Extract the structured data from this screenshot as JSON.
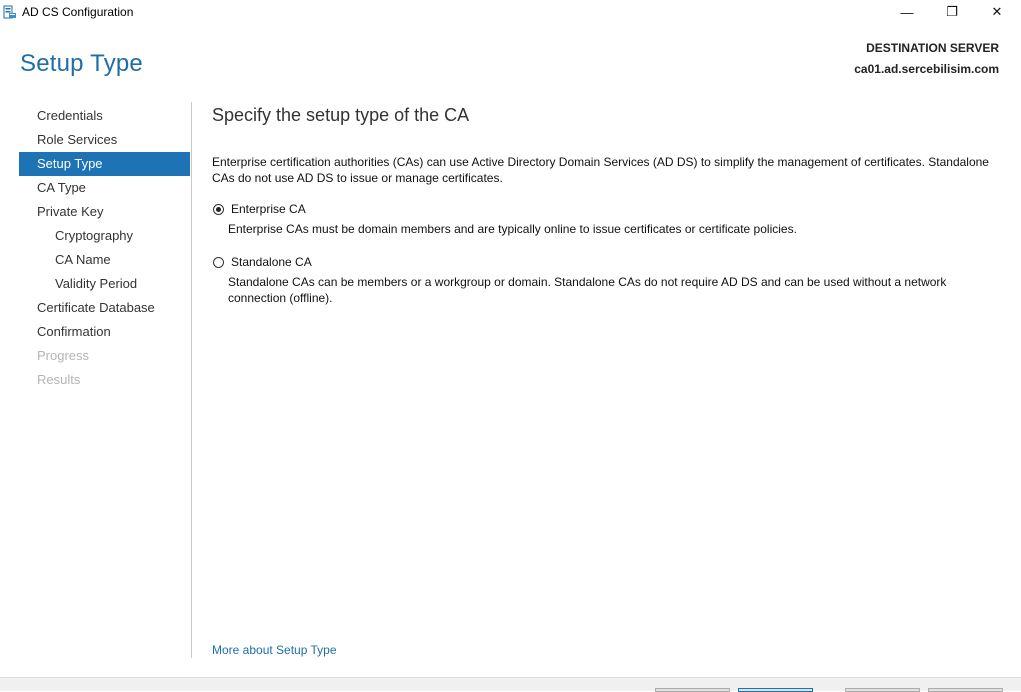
{
  "window": {
    "title": "AD CS Configuration",
    "minimize": "—",
    "maximize": "❐",
    "close": "✕"
  },
  "header": {
    "title": "Setup Type",
    "destination_label": "DESTINATION SERVER",
    "destination_server": "ca01.ad.sercebilisim.com"
  },
  "nav": {
    "items": [
      {
        "label": "Credentials",
        "state": "normal",
        "level": 0
      },
      {
        "label": "Role Services",
        "state": "normal",
        "level": 0
      },
      {
        "label": "Setup Type",
        "state": "active",
        "level": 0
      },
      {
        "label": "CA Type",
        "state": "normal",
        "level": 0
      },
      {
        "label": "Private Key",
        "state": "normal",
        "level": 0
      },
      {
        "label": "Cryptography",
        "state": "normal",
        "level": 1
      },
      {
        "label": "CA Name",
        "state": "normal",
        "level": 1
      },
      {
        "label": "Validity Period",
        "state": "normal",
        "level": 1
      },
      {
        "label": "Certificate Database",
        "state": "normal",
        "level": 0
      },
      {
        "label": "Confirmation",
        "state": "normal",
        "level": 0
      },
      {
        "label": "Progress",
        "state": "disabled",
        "level": 0
      },
      {
        "label": "Results",
        "state": "disabled",
        "level": 0
      }
    ]
  },
  "main": {
    "heading": "Specify the setup type of the CA",
    "description": "Enterprise certification authorities (CAs) can use Active Directory Domain Services (AD DS) to simplify the management of certificates. Standalone CAs do not use AD DS to issue or manage certificates.",
    "options": [
      {
        "label": "Enterprise CA",
        "checked": true,
        "description": "Enterprise CAs must be domain members and are typically online to issue certificates or certificate policies."
      },
      {
        "label": "Standalone CA",
        "checked": false,
        "description": "Standalone CAs can be members or a workgroup or domain. Standalone CAs do not require AD DS and can be used without a network connection (offline)."
      }
    ],
    "more_link": "More about Setup Type"
  },
  "colors": {
    "accent": "#1e73b4",
    "title_blue": "#1e6fa8",
    "disabled": "#b5b5b5"
  }
}
